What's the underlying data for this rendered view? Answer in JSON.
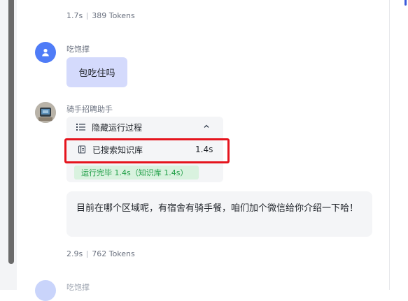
{
  "messages": {
    "prev_meta": {
      "duration": "1.7s",
      "tokens": "389 Tokens"
    },
    "user_message": {
      "sender": "吃饱撑",
      "text": "包吃住吗"
    },
    "bot_message": {
      "sender": "骑手招聘助手",
      "process": {
        "toggle_label": "隐藏运行过程",
        "kb_label": "已搜索知识库",
        "kb_time": "1.4s",
        "status": "运行完毕 1.4s（知识库 1.4s）"
      },
      "text": "目前在哪个区域呢，有宿舍有骑手餐，咱们加个微信给你介绍一下哈！",
      "meta": {
        "duration": "2.9s",
        "tokens": "762 Tokens"
      }
    },
    "next_user": {
      "sender": "吃饱撑"
    }
  },
  "colors": {
    "user_avatar": "#4f7cf7",
    "user_bubble": "#d4dafc",
    "highlight": "#e5141d",
    "status_text": "#1e9e45",
    "status_bg": "#d9f2df"
  },
  "icons": {
    "user_avatar": "person-icon",
    "toggle": "list-icon",
    "collapse": "chevron-up-icon",
    "knowledge": "document-icon"
  }
}
